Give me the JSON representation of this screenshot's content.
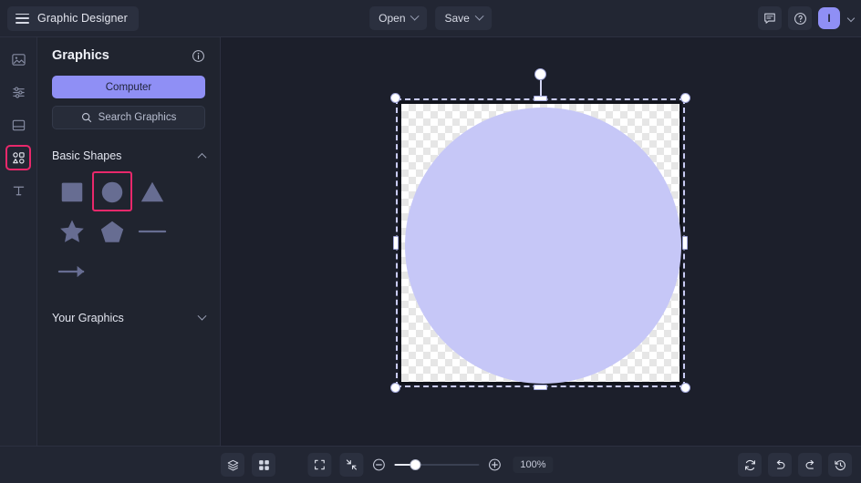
{
  "app": {
    "title": "Graphic Designer",
    "accent_purple": "#8f8ff5",
    "accent_pink": "#e8286b",
    "shape_fill": "#c6c7f7"
  },
  "topbar": {
    "menu_icon": "hamburger-icon",
    "open_label": "Open",
    "save_label": "Save",
    "comment_icon": "comment-icon",
    "help_icon": "help-circle-icon",
    "avatar_initial": "I",
    "avatar_chevron": "chevron-down-icon"
  },
  "rail": {
    "items": [
      {
        "name": "images",
        "icon": "image-icon",
        "active": false
      },
      {
        "name": "adjust",
        "icon": "sliders-icon",
        "active": false
      },
      {
        "name": "layout",
        "icon": "layout-icon",
        "active": false
      },
      {
        "name": "graphics",
        "icon": "shapes-grid-icon",
        "active": true
      },
      {
        "name": "text",
        "icon": "text-icon",
        "active": false
      }
    ]
  },
  "panel": {
    "title": "Graphics",
    "info_icon": "info-icon",
    "computer_label": "Computer",
    "search": {
      "placeholder": "Search Graphics",
      "icon": "search-icon"
    },
    "sections": [
      {
        "title": "Basic Shapes",
        "expanded": true,
        "chevron": "chevron-up-icon",
        "shapes": [
          {
            "name": "square",
            "selected": false
          },
          {
            "name": "circle",
            "selected": true
          },
          {
            "name": "triangle",
            "selected": false
          },
          {
            "name": "star",
            "selected": false
          },
          {
            "name": "pentagon",
            "selected": false
          },
          {
            "name": "line",
            "selected": false
          },
          {
            "name": "arrow",
            "selected": false
          }
        ]
      },
      {
        "title": "Your Graphics",
        "expanded": false,
        "chevron": "chevron-down-icon",
        "shapes": []
      }
    ]
  },
  "canvas": {
    "selected_object": "circle",
    "object_fill": "#c6c7f7",
    "background": "transparent-checkerboard",
    "handles": [
      "top-left",
      "top-center",
      "top-right",
      "middle-left",
      "middle-right",
      "bottom-left",
      "bottom-center",
      "bottom-right",
      "rotate"
    ]
  },
  "bottombar": {
    "layers_icon": "layers-icon",
    "grid_icon": "grid-icon",
    "fit_icon": "fit-frame-icon",
    "shrink_icon": "fit-screen-icon",
    "zoom_out_icon": "zoom-out-icon",
    "zoom_in_icon": "zoom-in-icon",
    "zoom_level": "100%",
    "slider_position_percent": 22,
    "reset_icon": "refresh-icon",
    "undo_icon": "undo-icon",
    "redo_icon": "redo-icon",
    "history_icon": "history-icon"
  }
}
